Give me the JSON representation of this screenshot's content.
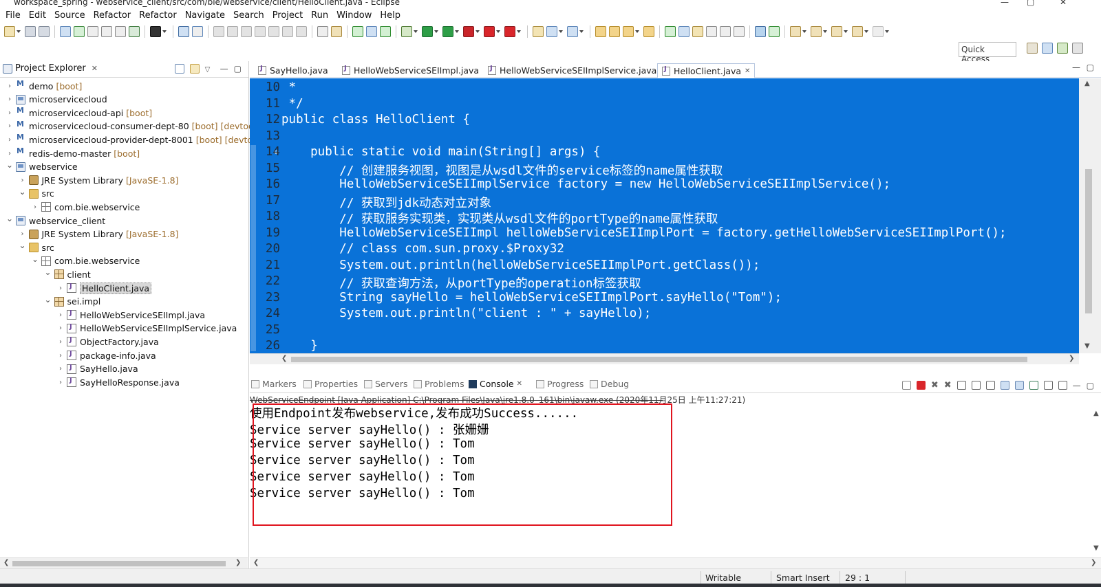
{
  "window": {
    "title": "workspace_spring - webservice_client/src/com/bie/webservice/client/HelloClient.java - Eclipse"
  },
  "menu": [
    "File",
    "Edit",
    "Source",
    "Refactor",
    "Refactor",
    "Navigate",
    "Search",
    "Project",
    "Run",
    "Window",
    "Help"
  ],
  "quick_access": {
    "label": "Quick Access"
  },
  "explorer": {
    "title": "Project Explorer",
    "items": [
      {
        "label": "demo",
        "decoration": "[boot]",
        "icon": "boot-project-icon",
        "level": 0,
        "expanded": false
      },
      {
        "label": "microservicecloud",
        "decoration": "",
        "icon": "project-icon",
        "level": 0,
        "expanded": false
      },
      {
        "label": "microservicecloud-api",
        "decoration": "[boot]",
        "icon": "boot-project-icon",
        "level": 0,
        "expanded": false
      },
      {
        "label": "microservicecloud-consumer-dept-80",
        "decoration": "[boot] [devtools]",
        "icon": "boot-project-icon",
        "level": 0,
        "expanded": false
      },
      {
        "label": "microservicecloud-provider-dept-8001",
        "decoration": "[boot] [devtools]",
        "icon": "boot-project-icon",
        "level": 0,
        "expanded": false
      },
      {
        "label": "redis-demo-master",
        "decoration": "[boot]",
        "icon": "boot-project-icon",
        "level": 0,
        "expanded": false
      },
      {
        "label": "webservice",
        "decoration": "",
        "icon": "project-icon",
        "level": 0,
        "expanded": true
      },
      {
        "label": "JRE System Library",
        "decoration": "[JavaSE-1.8]",
        "icon": "library-icon",
        "level": 1,
        "expanded": false
      },
      {
        "label": "src",
        "decoration": "",
        "icon": "source-folder-icon",
        "level": 1,
        "expanded": true
      },
      {
        "label": "com.bie.webservice",
        "decoration": "",
        "icon": "package-icon",
        "level": 2,
        "expanded": false
      },
      {
        "label": "webservice_client",
        "decoration": "",
        "icon": "project-icon",
        "level": 0,
        "expanded": true
      },
      {
        "label": "JRE System Library",
        "decoration": "[JavaSE-1.8]",
        "icon": "library-icon",
        "level": 1,
        "expanded": false
      },
      {
        "label": "src",
        "decoration": "",
        "icon": "source-folder-icon",
        "level": 1,
        "expanded": true
      },
      {
        "label": "com.bie.webservice",
        "decoration": "",
        "icon": "package-icon",
        "level": 2,
        "expanded": true
      },
      {
        "label": "client",
        "decoration": "",
        "icon": "package-icon",
        "level": 3,
        "expanded": true
      },
      {
        "label": "HelloClient.java",
        "decoration": "",
        "icon": "java-file-icon",
        "level": 4,
        "expanded": false,
        "selected": true
      },
      {
        "label": "sei.impl",
        "decoration": "",
        "icon": "package-icon",
        "level": 3,
        "expanded": true
      },
      {
        "label": "HelloWebServiceSEIImpl.java",
        "decoration": "",
        "icon": "java-file-icon",
        "level": 4,
        "expanded": false
      },
      {
        "label": "HelloWebServiceSEIImplService.java",
        "decoration": "",
        "icon": "java-file-icon",
        "level": 4,
        "expanded": false
      },
      {
        "label": "ObjectFactory.java",
        "decoration": "",
        "icon": "java-file-icon",
        "level": 4,
        "expanded": false
      },
      {
        "label": "package-info.java",
        "decoration": "",
        "icon": "java-file-icon",
        "level": 4,
        "expanded": false
      },
      {
        "label": "SayHello.java",
        "decoration": "",
        "icon": "java-file-icon",
        "level": 4,
        "expanded": false
      },
      {
        "label": "SayHelloResponse.java",
        "decoration": "",
        "icon": "java-file-icon",
        "level": 4,
        "expanded": false
      }
    ]
  },
  "editor": {
    "tabs": [
      {
        "label": "SayHello.java",
        "active": false
      },
      {
        "label": "HelloWebServiceSEIImpl.java",
        "active": false
      },
      {
        "label": "HelloWebServiceSEIImplService.java",
        "active": false
      },
      {
        "label": "HelloClient.java",
        "active": true
      }
    ],
    "lines": [
      {
        "n": "10",
        "text": " *"
      },
      {
        "n": "11",
        "text": " */"
      },
      {
        "n": "12",
        "text": "public class HelloClient {"
      },
      {
        "n": "13",
        "text": ""
      },
      {
        "n": "14",
        "text": "    public static void main(String[] args) {"
      },
      {
        "n": "15",
        "text": "        // 创建服务视图，视图是从wsdl文件的service标签的name属性获取"
      },
      {
        "n": "16",
        "text": "        HelloWebServiceSEIImplService factory = new HelloWebServiceSEIImplService();"
      },
      {
        "n": "17",
        "text": "        // 获取到jdk动态对立对象"
      },
      {
        "n": "18",
        "text": "        // 获取服务实现类，实现类从wsdl文件的portType的name属性获取"
      },
      {
        "n": "19",
        "text": "        HelloWebServiceSEIImpl helloWebServiceSEIImplPort = factory.getHelloWebServiceSEIImplPort();"
      },
      {
        "n": "20",
        "text": "        // class com.sun.proxy.$Proxy32"
      },
      {
        "n": "21",
        "text": "        System.out.println(helloWebServiceSEIImplPort.getClass());"
      },
      {
        "n": "22",
        "text": "        // 获取查询方法，从portType的operation标签获取"
      },
      {
        "n": "23",
        "text": "        String sayHello = helloWebServiceSEIImplPort.sayHello(\"Tom\");"
      },
      {
        "n": "24",
        "text": "        System.out.println(\"client : \" + sayHello);"
      },
      {
        "n": "25",
        "text": ""
      },
      {
        "n": "26",
        "text": "    }"
      }
    ]
  },
  "bottom_panel": {
    "tabs": [
      {
        "label": "Markers",
        "active": false
      },
      {
        "label": "Properties",
        "active": false
      },
      {
        "label": "Servers",
        "active": false
      },
      {
        "label": "Problems",
        "active": false
      },
      {
        "label": "Console",
        "active": true
      },
      {
        "label": "Progress",
        "active": false
      },
      {
        "label": "Debug",
        "active": false
      }
    ],
    "launch_info": "WebServiceEndpoint [Java Application] C:\\Program Files\\Java\\jre1.8.0_161\\bin\\javaw.exe (2020年11月25日 上午11:27:21)",
    "output": [
      "使用Endpoint发布webservice,发布成功Success......",
      "Service server sayHello() : 张姗姗",
      "Service server sayHello() : Tom",
      "Service server sayHello() : Tom",
      "Service server sayHello() : Tom",
      "Service server sayHello() : Tom"
    ]
  },
  "status": {
    "writable": "Writable",
    "insert_mode": "Smart Insert",
    "position": "29 : 1"
  },
  "colors": {
    "selection_bg": "#0a72d8",
    "highlight_box": "#e0141e"
  }
}
